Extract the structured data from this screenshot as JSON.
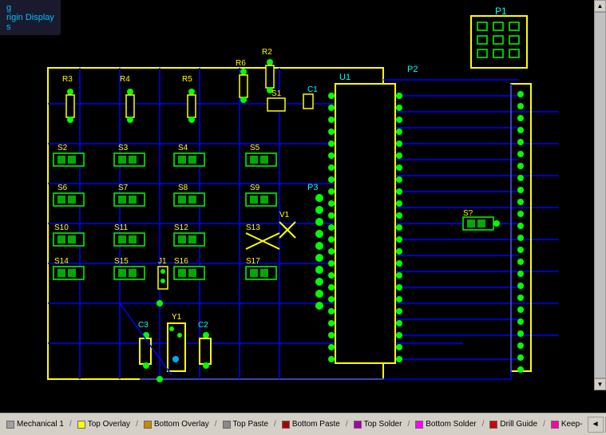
{
  "panel": {
    "title": "g",
    "line2": "rigin Display",
    "line3": "s"
  },
  "layers": [
    {
      "name": "Mechanical 1",
      "color": "#a0a0a0",
      "divider": "/"
    },
    {
      "name": "Top Overlay",
      "color": "#ffff00",
      "divider": "/"
    },
    {
      "name": "Bottom Overlay",
      "color": "#cc8800",
      "divider": "/"
    },
    {
      "name": "Top Paste",
      "color": "#888888",
      "divider": "/"
    },
    {
      "name": "Bottom Paste",
      "color": "#aa0000",
      "divider": "/"
    },
    {
      "name": "Top Solder",
      "color": "#aa00aa",
      "divider": "/"
    },
    {
      "name": "Bottom Solder",
      "color": "#ff00ff",
      "divider": "/"
    },
    {
      "name": "Drill Guide",
      "color": "#cc0000",
      "divider": "/"
    },
    {
      "name": "Keep-",
      "color": "#ff00aa",
      "divider": ""
    }
  ],
  "toolbar_icons": [
    "◄",
    "►",
    "▽"
  ]
}
